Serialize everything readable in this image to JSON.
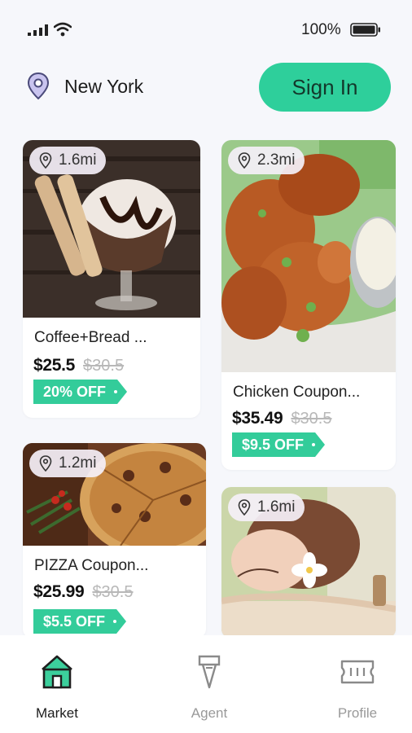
{
  "status_bar": {
    "battery": "100%"
  },
  "header": {
    "city": "New York",
    "sign_in_label": "Sign In"
  },
  "colors": {
    "accent": "#2ecf9b",
    "tag": "#33cc9a",
    "background": "#f6f7fb"
  },
  "deals": [
    {
      "distance": "1.6mi",
      "title": "Coffee+Bread ...",
      "price": "$25.5",
      "old_price": "$30.5",
      "discount": "20% OFF"
    },
    {
      "distance": "2.3mi",
      "title": "Chicken Coupon...",
      "price": "$35.49",
      "old_price": "$30.5",
      "discount": "$9.5 OFF"
    },
    {
      "distance": "1.2mi",
      "title": "PIZZA Coupon...",
      "price": "$25.99",
      "old_price": "$30.5",
      "discount": "$5.5 OFF"
    },
    {
      "distance": "1.6mi"
    }
  ],
  "nav": {
    "items": [
      {
        "label": "Market",
        "icon": "shop-icon",
        "active": true
      },
      {
        "label": "Agent",
        "icon": "agent-icon",
        "active": false
      },
      {
        "label": "Profile",
        "icon": "ticket-icon",
        "active": false
      }
    ]
  }
}
